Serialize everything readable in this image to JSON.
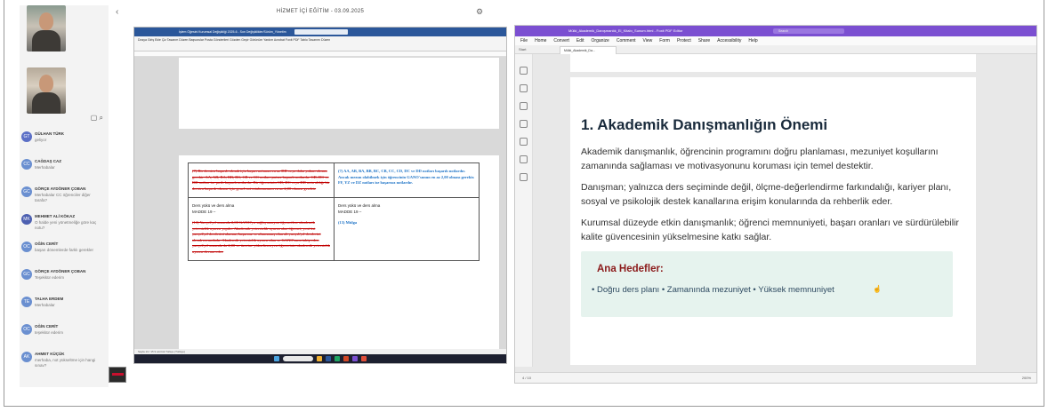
{
  "share": {
    "title": "HİZMET İÇİ EĞİTİM - 03.09.2025"
  },
  "chat": {
    "messages": [
      {
        "initials": "GT",
        "name": "GÜLHAN TÜRK",
        "text": "geliyor",
        "color": "#5b6fc6"
      },
      {
        "initials": "CC",
        "name": "CAĞDAŞ CAZ",
        "text": "Merhabalar",
        "color": "#6a8fd0"
      },
      {
        "initials": "GC",
        "name": "GÖRÇE AYDÖNER ÇOBAN",
        "text": "Merhabalar CC öğrenciler diğer tarafa?",
        "color": "#6a8fd0"
      },
      {
        "initials": "MK",
        "name": "MEHMET ALİ KÖKAZ",
        "text": "O halde yeni yönetmeliğe göre kaç notu?",
        "color": "#4c5fb0"
      },
      {
        "initials": "OC",
        "name": "OĞİN CERİT",
        "text": "başarı dönemlerde farklı gerekler",
        "color": "#6a8fd0"
      },
      {
        "initials": "GC",
        "name": "GÖRÇE AYDÖNER ÇOBAN",
        "text": "Teşekkür ederim",
        "color": "#6a8fd0"
      },
      {
        "initials": "TE",
        "name": "TALHA ERDEM",
        "text": "Merhabalar",
        "color": "#6a8fd0"
      },
      {
        "initials": "OC",
        "name": "OĞİN CERİT",
        "text": "teşekkür ederim",
        "color": "#6a8fd0"
      },
      {
        "initials": "AK",
        "name": "AHMET KÜÇÜK",
        "text": "merhaba, not yükseltme için hangi sınav?",
        "color": "#6a8fd0"
      }
    ]
  },
  "word": {
    "window_title": "İşlem Öğesini Kurumsal Değişikliği 2025-6 - Son Değişiklikler/Sürüm_Yönetim",
    "menu": "Dosya  Giriş  Ekle  Çiz  Tasarım  Düzen  Başvurular  Posta Gönderileri  Gözden Geçir  Görünüm  Yardım  Acrobat  Foxit PDF  Tablo Tasarımı  Düzen",
    "row1_left": "(7) Bir dersten başarılı olmak için başarı notunun en az DD veya daha yukarı olması gerekir. AA, AB, BA, BB, BC, CB ve CC notları şartsız başarılı notlardır. CD, DC ve DD notları ise şartlı başarılı notlardır. Bir öğrencinin CD, DC veya DD notu aldığı bir dersten başarılı olması için genel not ortalamasının en az 2,00 olması gerekir.",
    "row1_right": "(7) AA, AB, BA, BB, BC, CB, CC, CD, DC ve DD notları başarılı notlardır. Ancak mezun olabilmek için öğrencinin GANO'sunun en az 2,00 olması gerekir. FF, YZ ve DZ notları ise başarısız notlardır.",
    "row2_left_heading": "Ders yükü ve ders alma",
    "row2_left_article": "MADDE 19 –",
    "row2_left_body": "(13) Yarıyıl/yıl sonunda 2,00 GANO'yu sağlayamayan öğrencilere akademik yetersizlik uyarısı yapılır. Akademik yetersizlik uyarısı alan öğrenci, yeni üst yarıyıl/yıl derslerini alamaz; başarısız ve alınmamış olan alt yarıyıl/yıl derslerini almak zorundadır. Akademik yetersizlik uyarısı alan ve GANO'sunu takip eden yarıyıl/yıl sonunda da 2,00 ve üzerine yükseltemeyen öğrencinin akademik yetersizlik uyarısı devam eder.",
    "row2_right_heading": "Ders yükü ve ders alma",
    "row2_right_article": "MADDE 19 –",
    "row2_right_body": "(13) Mülga",
    "status": "Sayfa 13 / 15   9 sözcük   Türkçe (Türkiye)"
  },
  "pdf": {
    "window_title": "Mülki_Akademik_Danışmanlık_El_Kitabı_Sunum.html - Foxit PDF Editor",
    "search_placeholder": "Search",
    "menu": [
      "File",
      "Home",
      "Convert",
      "Edit",
      "Organize",
      "Comment",
      "View",
      "Form",
      "Protect",
      "Share",
      "Accessibility",
      "Help"
    ],
    "tab_start": "Start",
    "tab_doc": "Mülki_Akademik_Da...",
    "heading": "1. Akademik Danışmanlığın Önemi",
    "p1": "Akademik danışmanlık, öğrencinin programını doğru planlaması, mezuniyet koşullarını zamanında sağlaması ve motivasyonunu koruması için temel destektir.",
    "p2": "Danışman; yalnızca ders seçiminde değil, ölçme-değerlendirme farkındalığı, kariyer planı, sosyal ve psikolojik destek kanallarına erişim konularında da rehberlik eder.",
    "p3": "Kurumsal düzeyde etkin danışmanlık; öğrenci memnuniyeti, başarı oranları ve sürdürülebilir kalite güvencesinin yükselmesine katkı sağlar.",
    "goals_title": "Ana Hedefler:",
    "goals_list": "• Doğru ders planı  • Zamanında mezuniyet  • Yüksek memnuniyet",
    "page_indicator": "4 / 10",
    "zoom": "200%"
  },
  "colors": {
    "pdf_accent": "#7b4fd1",
    "word_accent": "#2b579a",
    "goals_bg": "#e6f3ee",
    "goals_title": "#8b1a1a"
  }
}
